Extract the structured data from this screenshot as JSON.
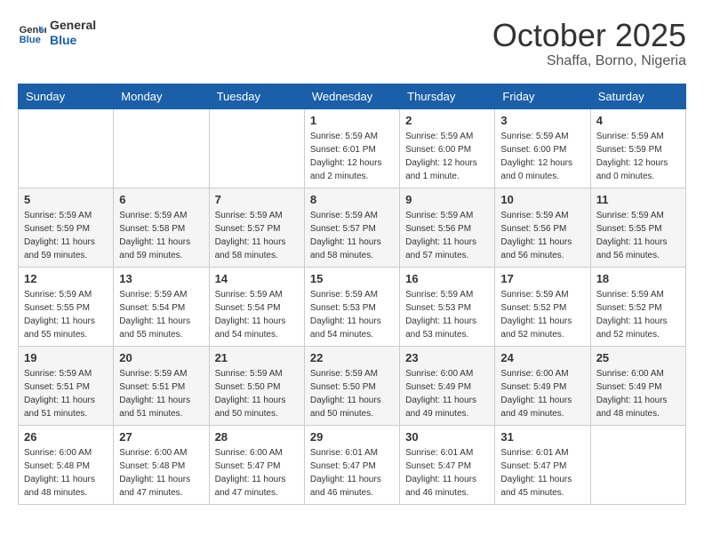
{
  "logo": {
    "line1": "General",
    "line2": "Blue"
  },
  "title": "October 2025",
  "location": "Shaffa, Borno, Nigeria",
  "weekdays": [
    "Sunday",
    "Monday",
    "Tuesday",
    "Wednesday",
    "Thursday",
    "Friday",
    "Saturday"
  ],
  "weeks": [
    [
      {
        "day": "",
        "info": ""
      },
      {
        "day": "",
        "info": ""
      },
      {
        "day": "",
        "info": ""
      },
      {
        "day": "1",
        "info": "Sunrise: 5:59 AM\nSunset: 6:01 PM\nDaylight: 12 hours\nand 2 minutes."
      },
      {
        "day": "2",
        "info": "Sunrise: 5:59 AM\nSunset: 6:00 PM\nDaylight: 12 hours\nand 1 minute."
      },
      {
        "day": "3",
        "info": "Sunrise: 5:59 AM\nSunset: 6:00 PM\nDaylight: 12 hours\nand 0 minutes."
      },
      {
        "day": "4",
        "info": "Sunrise: 5:59 AM\nSunset: 5:59 PM\nDaylight: 12 hours\nand 0 minutes."
      }
    ],
    [
      {
        "day": "5",
        "info": "Sunrise: 5:59 AM\nSunset: 5:59 PM\nDaylight: 11 hours\nand 59 minutes."
      },
      {
        "day": "6",
        "info": "Sunrise: 5:59 AM\nSunset: 5:58 PM\nDaylight: 11 hours\nand 59 minutes."
      },
      {
        "day": "7",
        "info": "Sunrise: 5:59 AM\nSunset: 5:57 PM\nDaylight: 11 hours\nand 58 minutes."
      },
      {
        "day": "8",
        "info": "Sunrise: 5:59 AM\nSunset: 5:57 PM\nDaylight: 11 hours\nand 58 minutes."
      },
      {
        "day": "9",
        "info": "Sunrise: 5:59 AM\nSunset: 5:56 PM\nDaylight: 11 hours\nand 57 minutes."
      },
      {
        "day": "10",
        "info": "Sunrise: 5:59 AM\nSunset: 5:56 PM\nDaylight: 11 hours\nand 56 minutes."
      },
      {
        "day": "11",
        "info": "Sunrise: 5:59 AM\nSunset: 5:55 PM\nDaylight: 11 hours\nand 56 minutes."
      }
    ],
    [
      {
        "day": "12",
        "info": "Sunrise: 5:59 AM\nSunset: 5:55 PM\nDaylight: 11 hours\nand 55 minutes."
      },
      {
        "day": "13",
        "info": "Sunrise: 5:59 AM\nSunset: 5:54 PM\nDaylight: 11 hours\nand 55 minutes."
      },
      {
        "day": "14",
        "info": "Sunrise: 5:59 AM\nSunset: 5:54 PM\nDaylight: 11 hours\nand 54 minutes."
      },
      {
        "day": "15",
        "info": "Sunrise: 5:59 AM\nSunset: 5:53 PM\nDaylight: 11 hours\nand 54 minutes."
      },
      {
        "day": "16",
        "info": "Sunrise: 5:59 AM\nSunset: 5:53 PM\nDaylight: 11 hours\nand 53 minutes."
      },
      {
        "day": "17",
        "info": "Sunrise: 5:59 AM\nSunset: 5:52 PM\nDaylight: 11 hours\nand 52 minutes."
      },
      {
        "day": "18",
        "info": "Sunrise: 5:59 AM\nSunset: 5:52 PM\nDaylight: 11 hours\nand 52 minutes."
      }
    ],
    [
      {
        "day": "19",
        "info": "Sunrise: 5:59 AM\nSunset: 5:51 PM\nDaylight: 11 hours\nand 51 minutes."
      },
      {
        "day": "20",
        "info": "Sunrise: 5:59 AM\nSunset: 5:51 PM\nDaylight: 11 hours\nand 51 minutes."
      },
      {
        "day": "21",
        "info": "Sunrise: 5:59 AM\nSunset: 5:50 PM\nDaylight: 11 hours\nand 50 minutes."
      },
      {
        "day": "22",
        "info": "Sunrise: 5:59 AM\nSunset: 5:50 PM\nDaylight: 11 hours\nand 50 minutes."
      },
      {
        "day": "23",
        "info": "Sunrise: 6:00 AM\nSunset: 5:49 PM\nDaylight: 11 hours\nand 49 minutes."
      },
      {
        "day": "24",
        "info": "Sunrise: 6:00 AM\nSunset: 5:49 PM\nDaylight: 11 hours\nand 49 minutes."
      },
      {
        "day": "25",
        "info": "Sunrise: 6:00 AM\nSunset: 5:49 PM\nDaylight: 11 hours\nand 48 minutes."
      }
    ],
    [
      {
        "day": "26",
        "info": "Sunrise: 6:00 AM\nSunset: 5:48 PM\nDaylight: 11 hours\nand 48 minutes."
      },
      {
        "day": "27",
        "info": "Sunrise: 6:00 AM\nSunset: 5:48 PM\nDaylight: 11 hours\nand 47 minutes."
      },
      {
        "day": "28",
        "info": "Sunrise: 6:00 AM\nSunset: 5:47 PM\nDaylight: 11 hours\nand 47 minutes."
      },
      {
        "day": "29",
        "info": "Sunrise: 6:01 AM\nSunset: 5:47 PM\nDaylight: 11 hours\nand 46 minutes."
      },
      {
        "day": "30",
        "info": "Sunrise: 6:01 AM\nSunset: 5:47 PM\nDaylight: 11 hours\nand 46 minutes."
      },
      {
        "day": "31",
        "info": "Sunrise: 6:01 AM\nSunset: 5:47 PM\nDaylight: 11 hours\nand 45 minutes."
      },
      {
        "day": "",
        "info": ""
      }
    ]
  ]
}
